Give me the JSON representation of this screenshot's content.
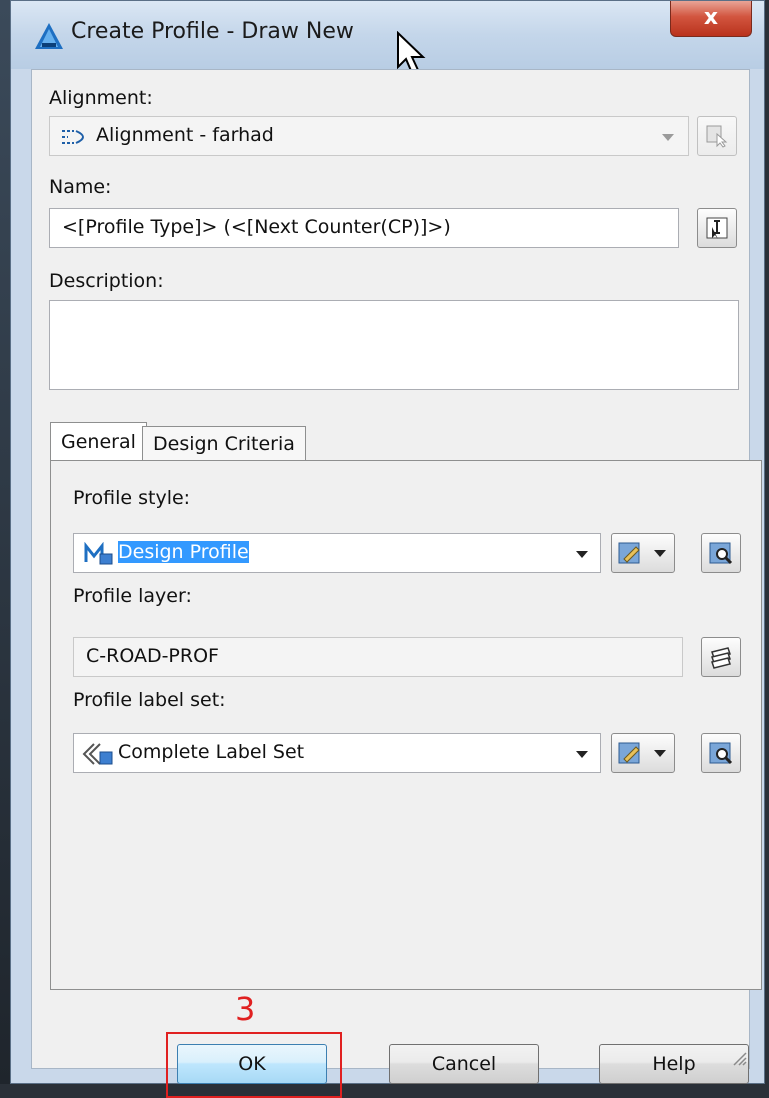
{
  "window": {
    "title": "Create Profile - Draw New",
    "close_label": "x"
  },
  "alignment": {
    "label": "Alignment:",
    "value": "Alignment - farhad"
  },
  "name": {
    "label": "Name:",
    "value": "<[Profile Type]> (<[Next Counter(CP)]>)"
  },
  "description": {
    "label": "Description:",
    "value": ""
  },
  "tabs": [
    {
      "label": "General",
      "active": true
    },
    {
      "label": "Design Criteria",
      "active": false
    }
  ],
  "general": {
    "profile_style": {
      "label": "Profile style:",
      "value": "Design Profile"
    },
    "profile_layer": {
      "label": "Profile layer:",
      "value": "C-ROAD-PROF"
    },
    "profile_label_set": {
      "label": "Profile label set:",
      "value": "Complete Label Set"
    }
  },
  "annotation": {
    "step_number": "3",
    "color": "#e02020"
  },
  "buttons": {
    "ok": "OK",
    "cancel": "Cancel",
    "help": "Help"
  }
}
